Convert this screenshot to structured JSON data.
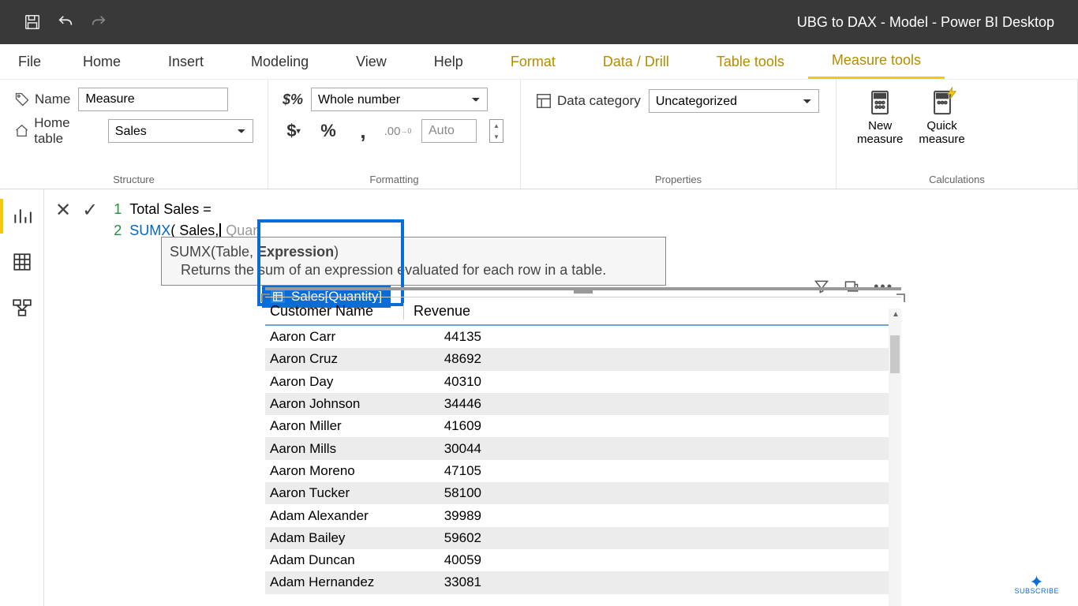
{
  "app": {
    "title": "UBG to DAX - Model - Power BI Desktop"
  },
  "tabs": {
    "file": "File",
    "home": "Home",
    "insert": "Insert",
    "modeling": "Modeling",
    "view": "View",
    "help": "Help",
    "format": "Format",
    "datadrill": "Data / Drill",
    "tabletools": "Table tools",
    "measuretools": "Measure tools"
  },
  "structure": {
    "name_label": "Name",
    "name_value": "Measure",
    "hometable_label": "Home table",
    "hometable_value": "Sales",
    "group_label": "Structure"
  },
  "formatting": {
    "format_value": "Whole number",
    "currency": "$",
    "percent": "%",
    "comma": ",",
    "decimals": ".00",
    "auto": "Auto",
    "group_label": "Formatting"
  },
  "properties": {
    "datacat_label": "Data category",
    "datacat_value": "Uncategorized",
    "group_label": "Properties"
  },
  "calculations": {
    "new_label": "New\nmeasure",
    "quick_label": "Quick\nmeasure",
    "group_label": "Calculations"
  },
  "formula": {
    "line1": "Total Sales =",
    "line2_kw": "SUMX",
    "line2_rest": "( Sales,",
    "line2_ghost": " Quan",
    "tooltip_sig_pre": "SUMX(Table, ",
    "tooltip_sig_bold": "Expression",
    "tooltip_sig_post": ")",
    "tooltip_desc": "Returns the sum of an expression evaluated for each row in a table.",
    "autocomplete": "Sales[Quantity]"
  },
  "visual": {
    "col1": "Customer Name",
    "col2": "Revenue",
    "rows": [
      {
        "n": "Aaron Carr",
        "v": "44135"
      },
      {
        "n": "Aaron Cruz",
        "v": "48692"
      },
      {
        "n": "Aaron Day",
        "v": "40310"
      },
      {
        "n": "Aaron Johnson",
        "v": "34446"
      },
      {
        "n": "Aaron Miller",
        "v": "41609"
      },
      {
        "n": "Aaron Mills",
        "v": "30044"
      },
      {
        "n": "Aaron Moreno",
        "v": "47105"
      },
      {
        "n": "Aaron Tucker",
        "v": "58100"
      },
      {
        "n": "Adam Alexander",
        "v": "39989"
      },
      {
        "n": "Adam Bailey",
        "v": "59602"
      },
      {
        "n": "Adam Duncan",
        "v": "40059"
      },
      {
        "n": "Adam Hernandez",
        "v": "33081"
      }
    ]
  },
  "subscribe": "SUBSCRIBE"
}
